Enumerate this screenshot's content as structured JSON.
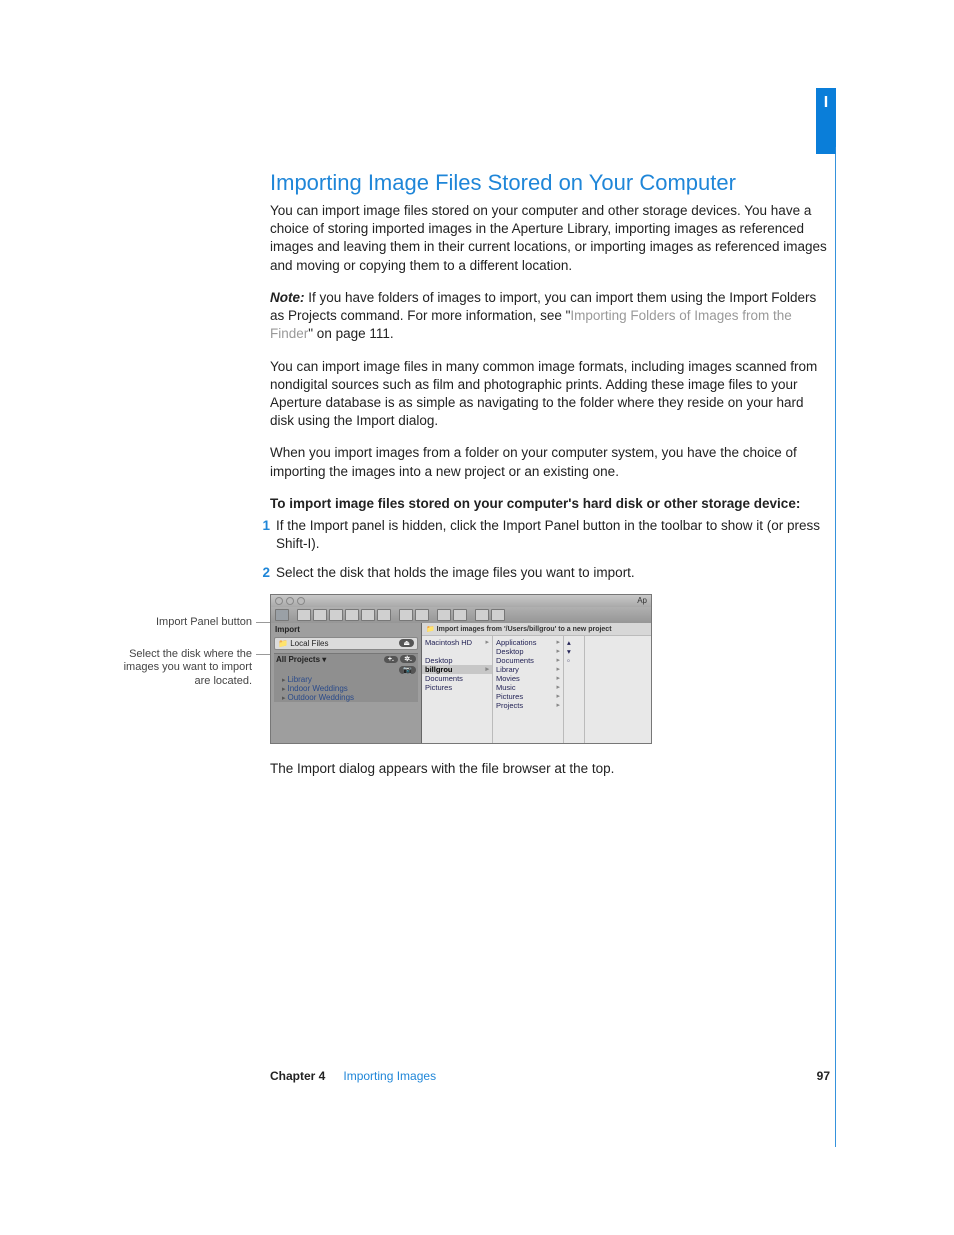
{
  "sideTab": "I",
  "heading": "Importing Image Files Stored on Your Computer",
  "para1": "You can import image files stored on your computer and other storage devices. You have a choice of storing imported images in the Aperture Library, importing images as referenced images and leaving them in their current locations, or importing images as referenced images and moving or copying them to a different location.",
  "noteLabel": "Note:",
  "noteBody": "  If you have folders of images to import, you can import them using the Import Folders as Projects command. For more information, see \"",
  "noteLink": "Importing Folders of Images from the Finder",
  "noteTail": "\" on page 111.",
  "para2": "You can import image files in many common image formats, including images scanned from nondigital sources such as film and photographic prints. Adding these image files to your Aperture database is as simple as navigating to the folder where they reside on your hard disk using the Import dialog.",
  "para3": "When you import images from a folder on your computer system, you have the choice of importing the images into a new project or an existing one.",
  "stepsIntro": "To import image files stored on your computer's hard disk or other storage device:",
  "steps": [
    {
      "num": "1",
      "text": "If the Import panel is hidden, click the Import Panel button in the toolbar to show it (or press Shift-I)."
    },
    {
      "num": "2",
      "text": "Select the disk that holds the image files you want to import."
    }
  ],
  "callout1": "Import Panel button",
  "callout2": "Select the disk where the images you want to import are located.",
  "afterFigure": "The Import dialog appears with the file browser at the top.",
  "screenshot": {
    "titleRight": "Ap",
    "importLabel": "Import",
    "localFiles": "Local Files",
    "eject": "⏏",
    "allProjects": "All Projects ▾",
    "plus": "+.",
    "gear": "✲.",
    "camPill": "📷",
    "projects": [
      "Library",
      "Indoor Weddings",
      "Outdoor Weddings"
    ],
    "rightHeader": "Import images from '/Users/billgrou' to a new project",
    "col1": [
      {
        "t": "Macintosh HD",
        "sel": false
      },
      {
        "t": "",
        "sel": false
      },
      {
        "t": "Desktop",
        "sel": false
      },
      {
        "t": "billgrou",
        "sel": true
      },
      {
        "t": "Documents",
        "sel": false
      },
      {
        "t": "Pictures",
        "sel": false
      }
    ],
    "col2": [
      {
        "t": "Applications"
      },
      {
        "t": "Desktop"
      },
      {
        "t": "Documents"
      },
      {
        "t": "Library"
      },
      {
        "t": "Movies"
      },
      {
        "t": "Music"
      },
      {
        "t": "Pictures"
      },
      {
        "t": "Projects"
      }
    ]
  },
  "footer": {
    "chapter": "Chapter 4",
    "title": "Importing Images",
    "page": "97"
  }
}
